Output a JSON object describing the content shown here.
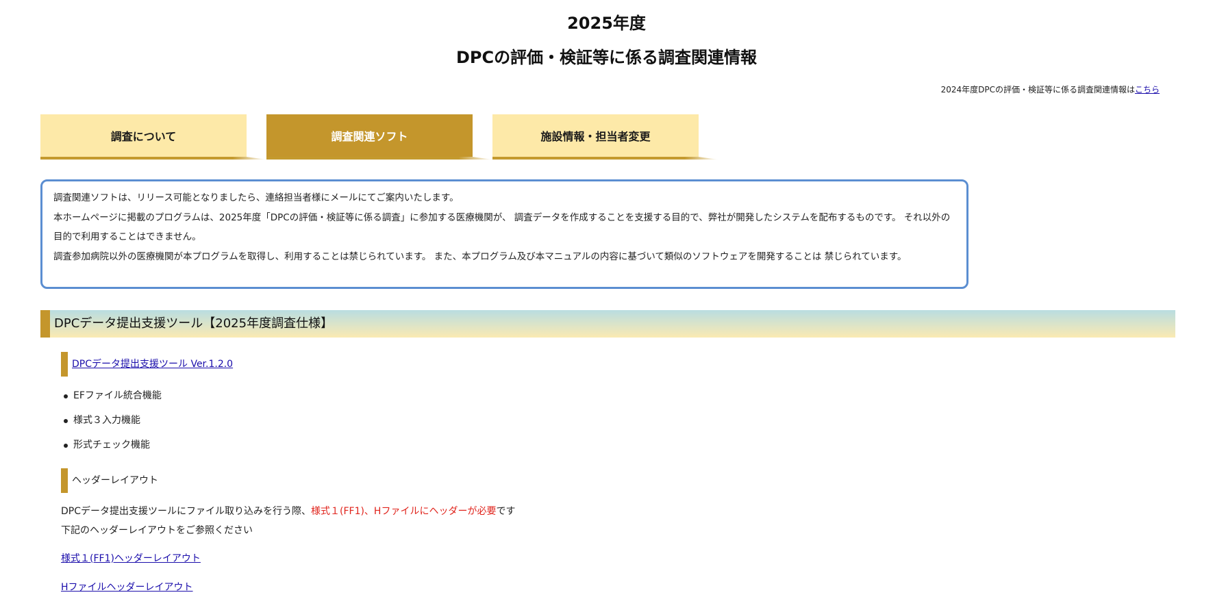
{
  "title": {
    "line1": "2025年度",
    "line2": "DPCの評価・検証等に係る調査関連情報"
  },
  "prev_year": {
    "text": "2024年度DPCの評価・検証等に係る調査関連情報は",
    "link_label": "こちら"
  },
  "tabs": [
    {
      "label": "調査について",
      "active": false
    },
    {
      "label": "調査関連ソフト",
      "active": true
    },
    {
      "label": "施設情報・担当者変更",
      "active": false
    }
  ],
  "notice": {
    "lines": [
      "調査関連ソフトは、リリース可能となりましたら、連絡担当者様にメールにてご案内いたします。",
      "本ホームページに掲載のプログラムは、2025年度「DPCの評価・検証等に係る調査」に参加する医療機関が、 調査データを作成することを支援する目的で、弊社が開発したシステムを配布するものです。 それ以外の目的で利用することはできません。",
      "調査参加病院以外の医療機関が本プログラムを取得し、利用することは禁じられています。 また、本プログラム及び本マニュアルの内容に基づいて類似のソフトウェアを開発することは 禁じられています。"
    ]
  },
  "section": {
    "title": "DPCデータ提出支援ツール【2025年度調査仕様】"
  },
  "tool": {
    "link_label": "DPCデータ提出支援ツール Ver.1.2.0",
    "features": [
      "EFファイル統合機能",
      "様式３入力機能",
      "形式チェック機能"
    ]
  },
  "header_layout": {
    "heading": "ヘッダーレイアウト",
    "desc_prefix": "DPCデータ提出支援ツールにファイル取り込みを行う際、",
    "desc_highlight": "様式１(FF1)、Hファイルにヘッダーが必要",
    "desc_suffix": "です",
    "desc_line2": "下記のヘッダーレイアウトをご参照ください",
    "ff1_link": "様式１(FF1)ヘッダーレイアウト",
    "h_link": "Hファイルヘッダーレイアウト"
  },
  "colors": {
    "accent_gold": "#c4962c",
    "tab_inactive": "#fde9a8",
    "notice_border": "#5b8ed1",
    "highlight_red": "#e0231b",
    "link_blue": "#1a0dab"
  }
}
